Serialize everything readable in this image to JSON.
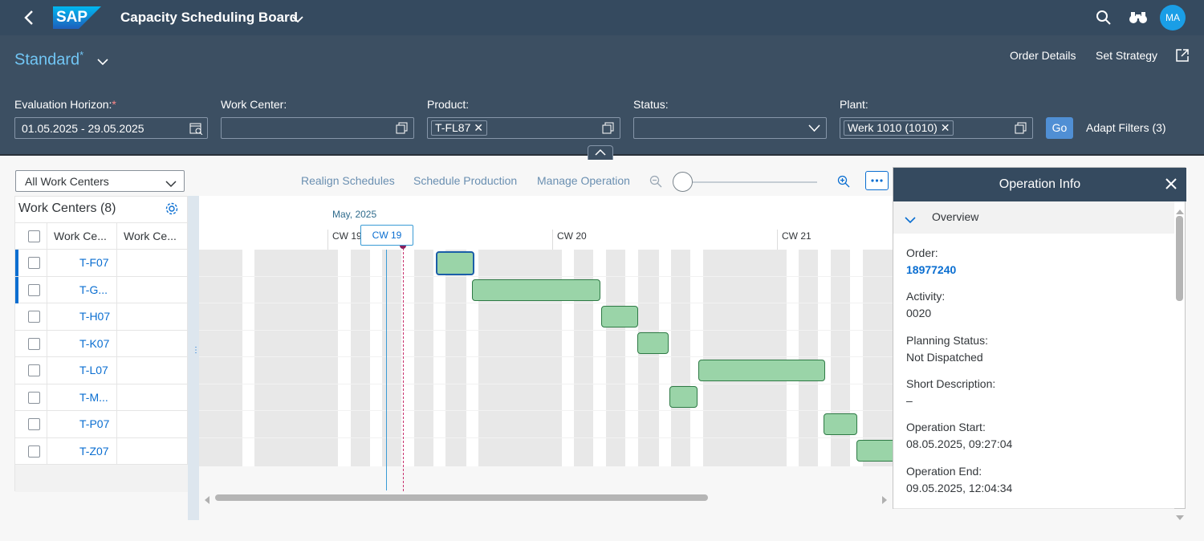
{
  "shell": {
    "title": "Capacity Scheduling Board",
    "avatar": "MA",
    "logo": "SAP"
  },
  "header": {
    "variant": "Standard",
    "variant_modified": "*",
    "actions": {
      "order_details": "Order Details",
      "set_strategy": "Set Strategy"
    },
    "filters": {
      "evaluation_horizon": {
        "label": "Evaluation Horizon:",
        "required": "*",
        "value": "01.05.2025 - 29.05.2025"
      },
      "work_center": {
        "label": "Work Center:",
        "value": ""
      },
      "product": {
        "label": "Product:",
        "token": "T-FL87"
      },
      "status": {
        "label": "Status:",
        "value": ""
      },
      "plant": {
        "label": "Plant:",
        "token": "Werk 1010 (1010)"
      }
    },
    "go": "Go",
    "adapt_filters": "Adapt Filters (3)"
  },
  "toolbar": {
    "work_center_select": "All Work Centers",
    "realign": "Realign Schedules",
    "schedule": "Schedule Production",
    "manage": "Manage Operation"
  },
  "work_centers": {
    "title": "Work Centers (8)",
    "col1": "Work Ce...",
    "col2": "Work Ce...",
    "rows": [
      "T-F07",
      "T-G...",
      "T-H07",
      "T-K07",
      "T-L07",
      "T-M...",
      "T-P07",
      "T-Z07"
    ]
  },
  "gantt": {
    "month": "May, 2025",
    "weeks": [
      "CW 19",
      "CW 20",
      "CW 21"
    ],
    "current_week": "CW 19"
  },
  "panel": {
    "title": "Operation Info",
    "section": "Overview",
    "fields": [
      {
        "label": "Order:",
        "value": "18977240"
      },
      {
        "label": "Activity:",
        "value": "0020"
      },
      {
        "label": "Planning Status:",
        "value": "Not Dispatched"
      },
      {
        "label": "Short Description:",
        "value": "–"
      },
      {
        "label": "Operation Start:",
        "value": "08.05.2025, 09:27:04"
      },
      {
        "label": "Operation End:",
        "value": "09.05.2025, 12:04:34"
      }
    ]
  },
  "colors": {
    "shell": "#354a5f",
    "header": "#3c4f62",
    "accent": "#0a6ed1",
    "bar": "#9ad4a8"
  }
}
